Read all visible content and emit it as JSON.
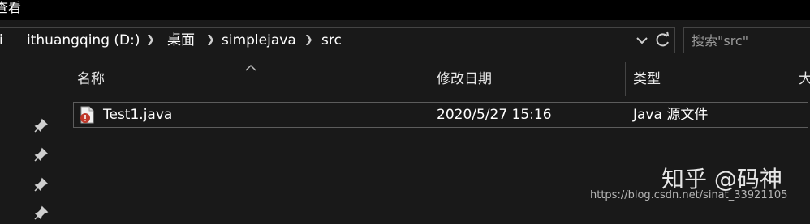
{
  "menubar": {
    "view_label": "查看"
  },
  "address": {
    "crumbs": [
      "i",
      "ithuangqing (D:)",
      "桌面",
      "simplejava",
      "src"
    ],
    "separator_icon": "chevron-right-icon",
    "dropdown_icon": "chevron-down-icon",
    "refresh_icon": "refresh-icon"
  },
  "search": {
    "placeholder": "搜索\"src\""
  },
  "columns": {
    "name": "名称",
    "date": "修改日期",
    "type": "类型",
    "size": "大"
  },
  "files": [
    {
      "name": "Test1.java",
      "date": "2020/5/27 15:16",
      "type": "Java 源文件",
      "icon": "java-file-icon"
    }
  ],
  "watermark": {
    "site_name": "知乎 @码神",
    "url": "https://blog.csdn.net/sinat_33921105"
  },
  "colors": {
    "background": "#191919",
    "menubar": "#000000",
    "border": "#444444",
    "text": "#ffffff"
  }
}
